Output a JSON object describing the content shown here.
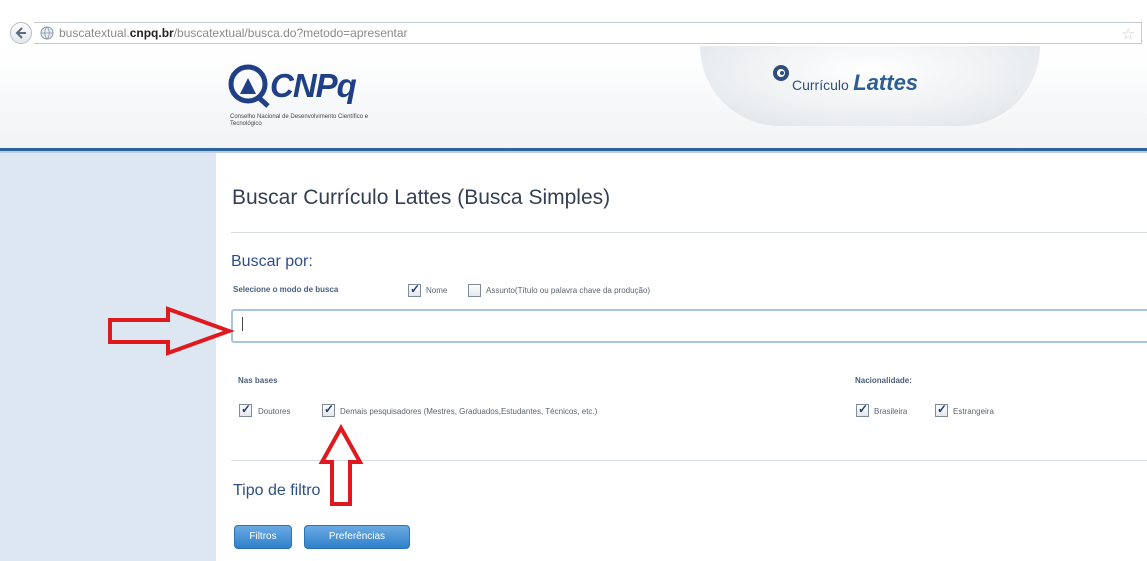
{
  "caption": {
    "text": ""
  },
  "browser": {
    "url_prefix": "buscatextual.",
    "url_domain": "cnpq.br",
    "url_path": "/buscatextual/busca.do?metodo=apresentar"
  },
  "header": {
    "logo_name": "CNPq",
    "logo_subtitle": "Conselho Nacional de Desenvolvimento Científico e Tecnológico",
    "lattes_small": "Currículo",
    "lattes_big": "Lattes"
  },
  "main": {
    "title": "Buscar Currículo Lattes (Busca Simples)",
    "buscar_por": "Buscar por:",
    "modo_label": "Selecione o modo de busca",
    "modo_options": [
      {
        "label": "Nome",
        "checked": true
      },
      {
        "label": "Assunto(Título ou palavra chave da produção)",
        "checked": false
      }
    ],
    "search_value": "",
    "bases_label": "Nas bases",
    "bases_options": [
      {
        "label": "Doutores",
        "checked": true
      },
      {
        "label": "Demais pesquisadores (Mestres, Graduados,Estudantes, Técnicos, etc.)",
        "checked": true
      }
    ],
    "nacionalidade_label": "Nacionalidade:",
    "nacionalidade_options": [
      {
        "label": "Brasileira",
        "checked": true
      },
      {
        "label": "Estrangeira",
        "checked": true
      }
    ],
    "tipo_filtro": "Tipo de filtro",
    "buttons": {
      "filtros": "Filtros",
      "preferencias": "Preferências"
    }
  },
  "annotations": {
    "arrow_color": "#e0191e"
  }
}
